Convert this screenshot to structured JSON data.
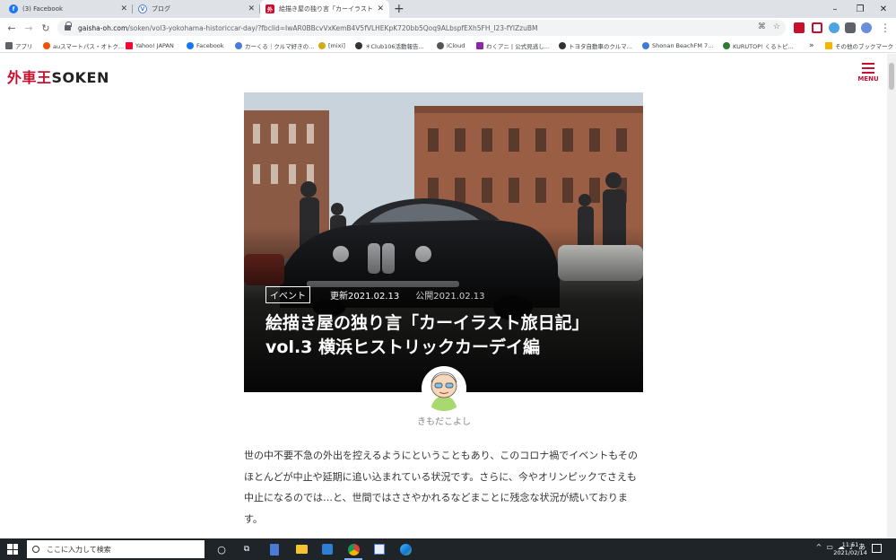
{
  "browser": {
    "tabs": [
      {
        "title": "(3) Facebook",
        "icon": "facebook-icon",
        "color": "#1877f2",
        "glyph": "f"
      },
      {
        "title": "ブログ",
        "icon": "blog-icon",
        "color": "#4a7bd8",
        "glyph": "V"
      },
      {
        "title": "絵描き屋の独り言「カーイラスト旅日記」",
        "icon": "gaisha-oh-icon",
        "color": "#c8102e",
        "glyph": "外"
      }
    ],
    "new_tab": "+",
    "window_controls": {
      "minimize": "–",
      "restore": "❐",
      "close": "✕"
    },
    "url_host": "gaisha-oh.com",
    "url_path": "/soken/vol3-yokohama-historiccar-day/?fbclid=IwAR0BBcvVxKemB4V5fVLHEKpK720bb5Qoq9ALbspfEXh5FH_I23-fYlZzuBM",
    "bookmarks": [
      {
        "label": "アプリ",
        "color": "#5f6368"
      },
      {
        "label": "auスマートパス・オトク...",
        "color": "#eb5505"
      },
      {
        "label": "Yahoo! JAPAN",
        "color": "#ff0033"
      },
      {
        "label": "Facebook",
        "color": "#1877f2"
      },
      {
        "label": "カーくる｜クルマ好きの...",
        "color": "#4a7bd8"
      },
      {
        "label": "[mixi]",
        "color": "#d1ad12"
      },
      {
        "label": "＊Club106活動報告...",
        "color": "#333333"
      },
      {
        "label": "iCloud",
        "color": "#555555"
      },
      {
        "label": "わくアニ | 公式見逃し...",
        "color": "#8e24aa"
      },
      {
        "label": "トヨタ自動車のクルマ...",
        "color": "#333333"
      },
      {
        "label": "Shonan BeachFM 7...",
        "color": "#3d7bd8"
      },
      {
        "label": "KURUTOP! くるトピ...",
        "color": "#2e7d32"
      },
      {
        "label": "»",
        "color": "#ffffff"
      },
      {
        "label": "その他のブックマーク",
        "color": "#f4b400"
      }
    ]
  },
  "site": {
    "logo_red": "外車王",
    "logo_dark": "SOKEN",
    "menu_label": "MENU"
  },
  "article": {
    "category": "イベント",
    "updated": "更新2021.02.13",
    "published": "公開2021.02.13",
    "title": "絵描き屋の独り言「カーイラスト旅日記」vol.3 横浜ヒストリックカーデイ編",
    "author": "きもだこよし",
    "body": "世の中不要不急の外出を控えるようにということもあり、このコロナ禍でイベントもそのほとんどが中止や延期に追い込まれている状況です。さらに、今やオリンピックでさえも中止になるのでは…と、世間ではささやかれるなどまことに残念な状況が続いております。"
  },
  "taskbar": {
    "search_placeholder": "ここに入力して検索",
    "time": "11:51",
    "date": "2021/02/14",
    "ime": "あ"
  }
}
